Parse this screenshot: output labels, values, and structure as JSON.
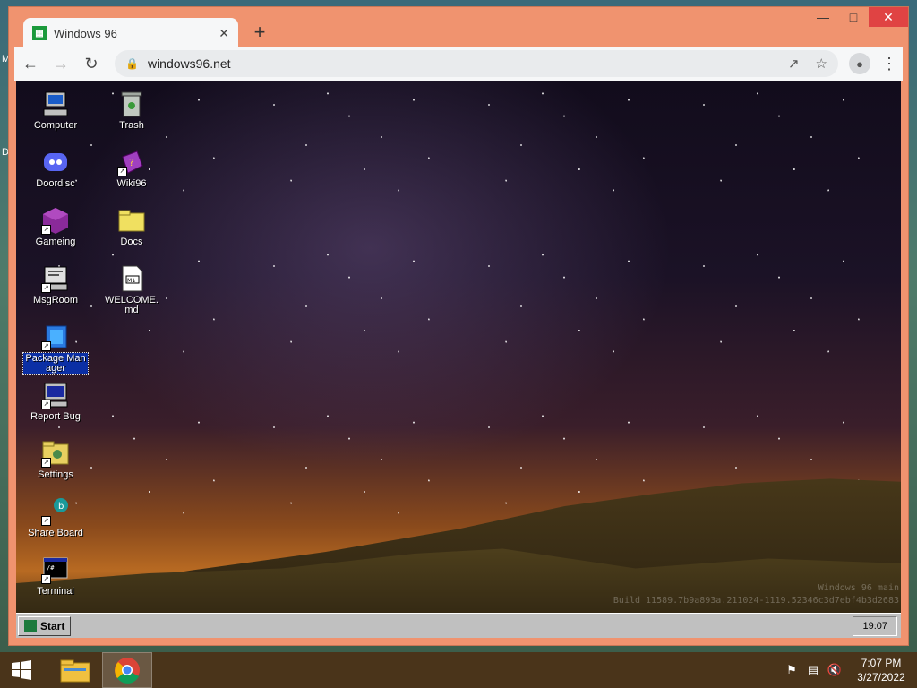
{
  "host": {
    "left_edge_labels": [
      "M",
      "D"
    ]
  },
  "browser": {
    "tab_title": "Windows 96",
    "url": "windows96.net",
    "window_controls": [
      "minimize-icon",
      "maximize-icon",
      "close-icon"
    ]
  },
  "desktop": {
    "icons": [
      {
        "label": "Computer",
        "icon": "computer-icon",
        "shortcut": false
      },
      {
        "label": "Trash",
        "icon": "trash-icon",
        "shortcut": false
      },
      {
        "label": "Doordisc",
        "icon": "doordisc-icon",
        "shortcut": false
      },
      {
        "label": "Wiki96",
        "icon": "wiki-book-icon",
        "shortcut": true
      },
      {
        "label": "Gameing",
        "icon": "cube-icon",
        "shortcut": true
      },
      {
        "label": "Docs",
        "icon": "folder-icon",
        "shortcut": false
      },
      {
        "label": "MsgRoom",
        "icon": "msgroom-icon",
        "shortcut": true
      },
      {
        "label": "WELCOME.md",
        "icon": "markdown-file-icon",
        "shortcut": false
      },
      {
        "label": "Package Manager",
        "icon": "package-icon",
        "shortcut": true,
        "selected": true
      },
      {
        "label": "Report Bug",
        "icon": "monitor-icon",
        "shortcut": true
      },
      {
        "label": "Settings",
        "icon": "settings-folder-icon",
        "shortcut": true
      },
      {
        "label": "Share Board",
        "icon": "share-board-icon",
        "shortcut": true
      },
      {
        "label": "Terminal",
        "icon": "terminal-icon",
        "shortcut": true
      }
    ],
    "watermark_line1": "Windows 96 main",
    "watermark_line2": "Build 11589.7b9a893a.211024-1119.52346c3d7ebf4b3d2683"
  },
  "w96_taskbar": {
    "start_label": "Start",
    "clock": "19:07"
  },
  "host_taskbar": {
    "time": "7:07 PM",
    "date": "3/27/2022",
    "apps": [
      "file-explorer-icon",
      "chrome-icon"
    ],
    "active_app": "chrome-icon"
  },
  "colors": {
    "chrome_frame": "#f0936f",
    "selection": "#0b2fa5",
    "close_button": "#e04343"
  }
}
